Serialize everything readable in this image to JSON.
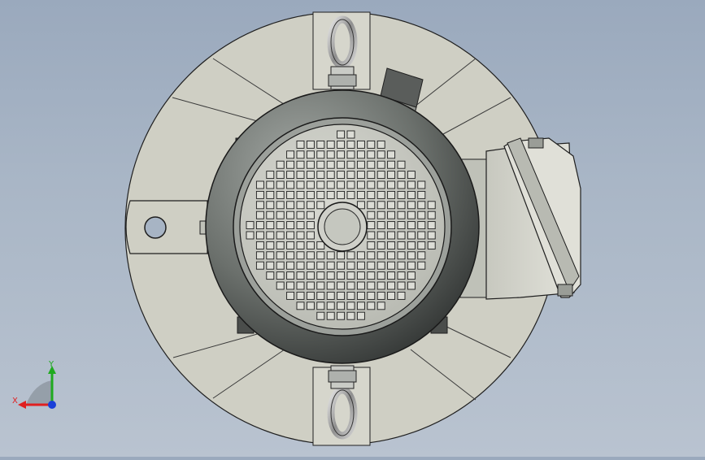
{
  "viewport": {
    "background_top": "#9aa9bd",
    "background_bottom": "#b9c3d0",
    "part_fill": "#cfcfc4",
    "part_stroke": "#2a2a2a",
    "motor_dark": "#3a3d3c",
    "motor_light": "#8e938f"
  },
  "triad": {
    "x_label": "X",
    "y_label": "Y",
    "x_color": "#e02020",
    "y_color": "#1faa1f",
    "z_color": "#1a3fd8"
  }
}
